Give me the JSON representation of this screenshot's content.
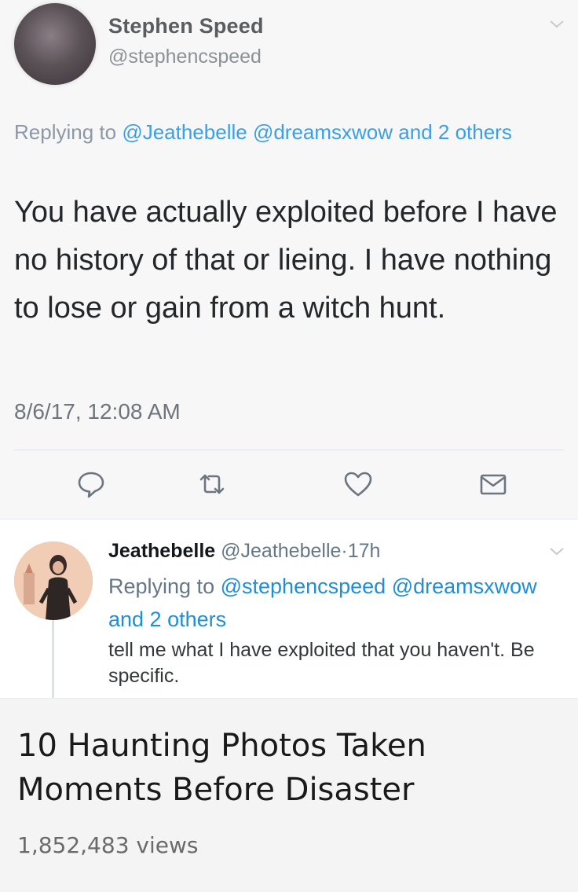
{
  "main_tweet": {
    "author_name": "Stephen Speed",
    "author_handle": "@stephencspeed",
    "replying_prefix": "Replying to",
    "replying_mention_1": "@Jeathebelle",
    "replying_mention_2": "@dreamsxwow",
    "replying_suffix": "and 2 others",
    "text": "You have actually exploited before I have no history of that or lieing.  I have nothing to lose or gain from a witch hunt.",
    "timestamp": "8/6/17, 12:08 AM",
    "actions": [
      "reply-icon",
      "retweet-icon",
      "like-icon",
      "dm-icon"
    ]
  },
  "reply_tweet": {
    "author_name": "Jeathebelle",
    "author_handle": "@Jeathebelle",
    "separator": "·",
    "time": "17h",
    "replying_prefix": "Replying to",
    "replying_mention_1": "@stephencspeed",
    "replying_mention_2": "@dreamsxwow",
    "replying_suffix": "and 2 others",
    "text": "tell me what I have exploited that you haven't. Be specific."
  },
  "video": {
    "title": "10 Haunting Photos Taken Moments Before Disaster",
    "views": "1,852,483 views"
  },
  "colors": {
    "mention_blue": "#3b9fe8",
    "text_dark": "#14171a",
    "meta_gray": "#657786"
  }
}
